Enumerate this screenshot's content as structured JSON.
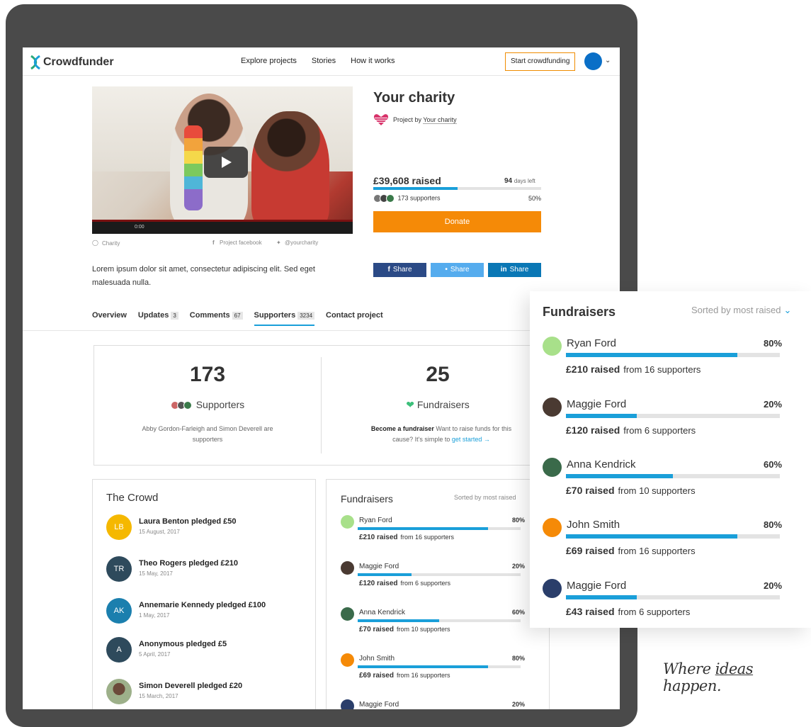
{
  "brand": {
    "name": "Crowdfunder",
    "accent": "#f58a07",
    "link_blue": "#1a9fd9"
  },
  "nav": {
    "links": [
      "Explore projects",
      "Stories",
      "How it works"
    ],
    "start_button": "Start crowdfunding",
    "chevron": "chevron-down-icon"
  },
  "video": {
    "time": "0:00"
  },
  "project": {
    "title": "Your charity",
    "by_prefix": "Project by",
    "by_name": "Your charity",
    "meta": {
      "category": "Charity",
      "facebook": "Project facebook",
      "twitter": "@yourcharity"
    },
    "description": "Lorem ipsum dolor sit amet, consectetur adipiscing elit. Sed eget malesuada nulla.",
    "raised": "£39,608 raised",
    "days_num": "94",
    "days_label": "days left",
    "progress": 0.5,
    "supporters": "173 supporters",
    "percent": "50%",
    "donate": "Donate",
    "shares": [
      {
        "label": "Share",
        "icon": "facebook-icon",
        "glyph": "f",
        "color": "#2b4a86"
      },
      {
        "label": "Share",
        "icon": "twitter-icon",
        "glyph": "•",
        "color": "#55acee"
      },
      {
        "label": "Share",
        "icon": "linkedin-icon",
        "glyph": "in",
        "color": "#0a77b5"
      }
    ]
  },
  "tabs": [
    {
      "label": "Overview",
      "count": ""
    },
    {
      "label": "Updates",
      "count": "3"
    },
    {
      "label": "Comments",
      "count": "67"
    },
    {
      "label": "Supporters",
      "count": "3234"
    },
    {
      "label": "Contact project",
      "count": ""
    }
  ],
  "stats": {
    "supporters_num": "173",
    "supporters_label": "Supporters",
    "supporters_sub": "Abby Gordon-Farleigh and Simon Deverell are supporters",
    "fundraisers_num": "25",
    "fundraisers_label": "Fundraisers",
    "fundraisers_sub_bold": "Become a fundraiser",
    "fundraisers_sub": "Want to raise funds for this cause? It's simple to",
    "fundraisers_link": "get started →"
  },
  "crowd": {
    "title": "The Crowd",
    "items": [
      {
        "initials": "LB",
        "color": "#f5b800",
        "text": "Laura Benton pledged £50",
        "date": "15 August, 2017"
      },
      {
        "initials": "TR",
        "color": "#2e4a5c",
        "text": "Theo Rogers pledged £210",
        "date": "15 May, 2017"
      },
      {
        "initials": "AK",
        "color": "#1b7fae",
        "text": "Annemarie Kennedy pledged £100",
        "date": "1 May, 2017"
      },
      {
        "initials": "A",
        "color": "#2e4a5c",
        "text": "Anonymous pledged £5",
        "date": "5 April, 2017"
      },
      {
        "initials": "",
        "color": "#9db08a",
        "text": "Simon Deverell pledged £20",
        "date": "15 March, 2017"
      }
    ]
  },
  "fundraisers": {
    "title": "Fundraisers",
    "sort": "Sorted by most raised",
    "items": [
      {
        "name": "Ryan Ford",
        "pct": "80%",
        "progress": 0.8,
        "raised": "£210 raised",
        "from": "from 16 supporters",
        "color": "#a8e08a"
      },
      {
        "name": "Maggie Ford",
        "pct": "20%",
        "progress": 0.33,
        "raised": "£120 raised",
        "from": "from 6 supporters",
        "color": "#4a3a32"
      },
      {
        "name": "Anna Kendrick",
        "pct": "60%",
        "progress": 0.5,
        "raised": "£70 raised",
        "from": "from 10 supporters",
        "color": "#3a6a4a"
      },
      {
        "name": "John Smith",
        "pct": "80%",
        "progress": 0.8,
        "raised": "£69 raised",
        "from": "from 16 supporters",
        "color": "#f58a07"
      },
      {
        "name": "Maggie Ford",
        "pct": "20%",
        "progress": 0.33,
        "raised": "£43 raised",
        "from": "from 6 supporters",
        "color": "#2a3e6a"
      }
    ]
  },
  "tagline": {
    "pre": "Where ",
    "mid": "ideas",
    "post": " happen."
  }
}
